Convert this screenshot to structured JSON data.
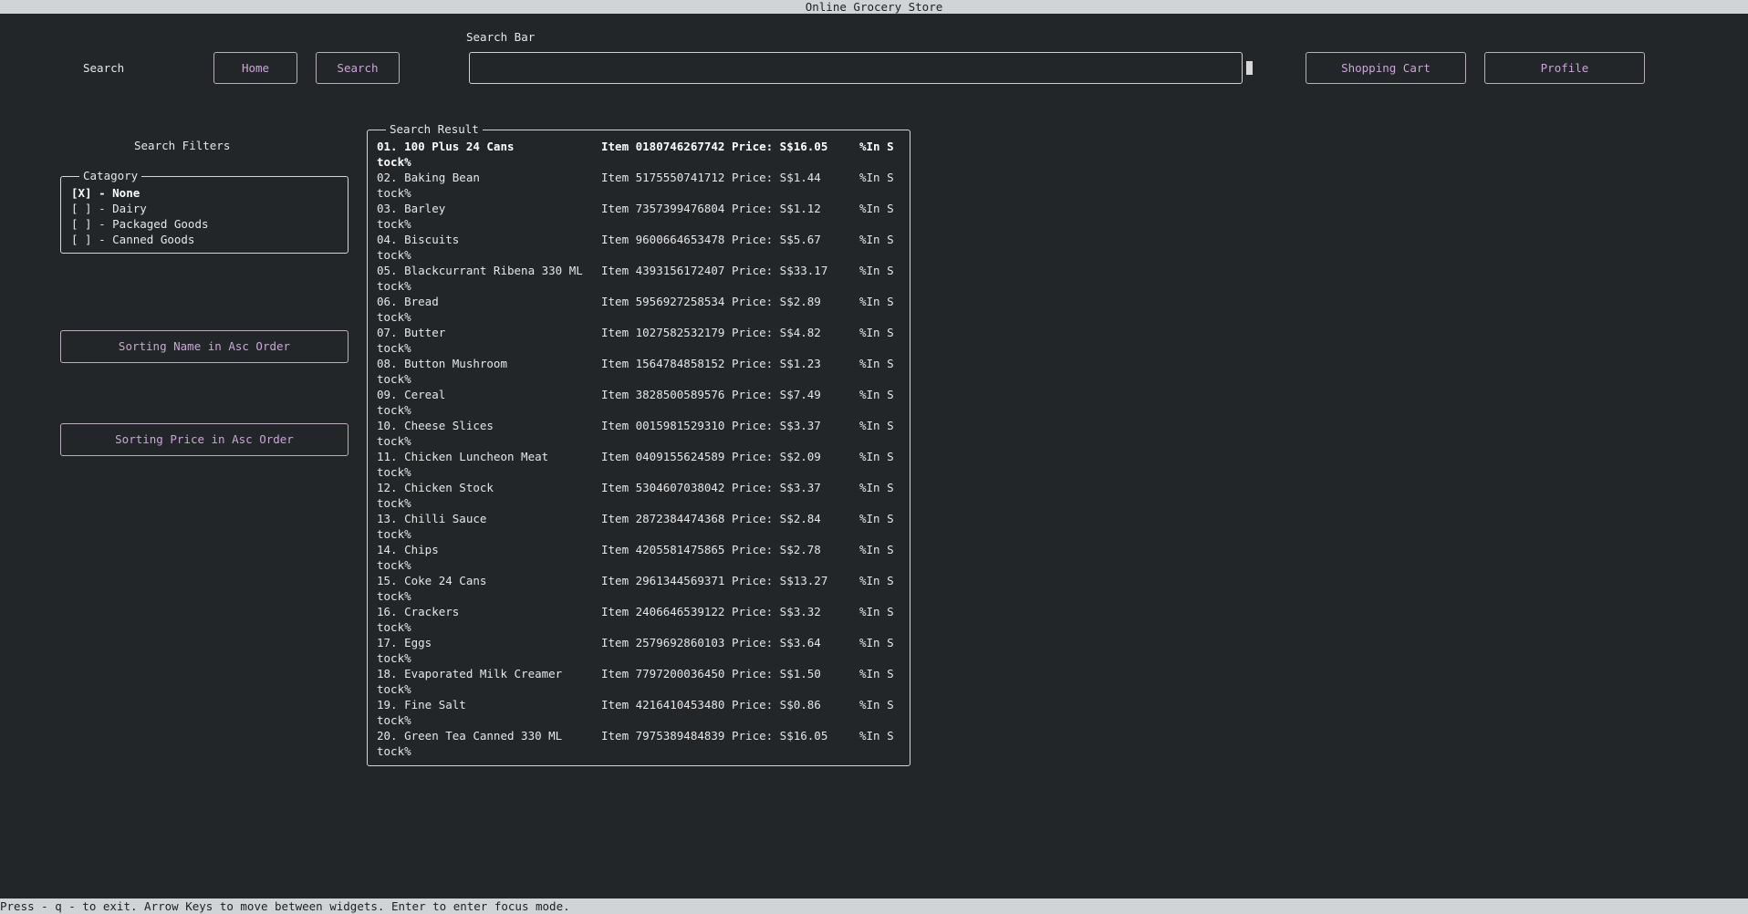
{
  "window": {
    "title": "Online Grocery Store",
    "status_hint": "Press - q - to exit. Arrow Keys to move between widgets. Enter to enter focus mode."
  },
  "nav": {
    "search_label": "Search",
    "home_button": "Home",
    "search_button": "Search",
    "search_bar_label": "Search Bar",
    "search_value": "",
    "cart_button": "Shopping Cart",
    "profile_button": "Profile"
  },
  "filters": {
    "heading": "Search Filters",
    "category_title": "Catagory",
    "categories": [
      {
        "text": "[X] - None",
        "checked": true
      },
      {
        "text": "[ ] - Dairy",
        "checked": false
      },
      {
        "text": "[ ] - Packaged Goods",
        "checked": false
      },
      {
        "text": "[ ] - Canned Goods",
        "checked": false
      }
    ],
    "sort_name_button": "Sorting Name in Asc Order",
    "sort_price_button": "Sorting Price in Asc Order"
  },
  "results": {
    "title": "Search Result",
    "stock_head": "%In S",
    "stock_tail": "tock%",
    "items": [
      {
        "name": "01. 100 Plus 24 Cans",
        "item": "Item 0180746267742 Price: S$16.05"
      },
      {
        "name": "02. Baking Bean",
        "item": "Item 5175550741712 Price: S$1.44"
      },
      {
        "name": "03. Barley",
        "item": "Item 7357399476804 Price: S$1.12"
      },
      {
        "name": "04. Biscuits",
        "item": "Item 9600664653478 Price: S$5.67"
      },
      {
        "name": "05. Blackcurrant Ribena 330 ML",
        "item": "Item 4393156172407 Price: S$33.17"
      },
      {
        "name": "06. Bread",
        "item": "Item 5956927258534 Price: S$2.89"
      },
      {
        "name": "07. Butter",
        "item": "Item 1027582532179 Price: S$4.82"
      },
      {
        "name": "08. Button Mushroom",
        "item": "Item 1564784858152 Price: S$1.23"
      },
      {
        "name": "09. Cereal",
        "item": "Item 3828500589576 Price: S$7.49"
      },
      {
        "name": "10. Cheese Slices",
        "item": "Item 0015981529310 Price: S$3.37"
      },
      {
        "name": "11. Chicken Luncheon Meat",
        "item": "Item 0409155624589 Price: S$2.09"
      },
      {
        "name": "12. Chicken Stock",
        "item": "Item 5304607038042 Price: S$3.37"
      },
      {
        "name": "13. Chilli Sauce",
        "item": "Item 2872384474368 Price: S$2.84"
      },
      {
        "name": "14. Chips",
        "item": "Item 4205581475865 Price: S$2.78"
      },
      {
        "name": "15. Coke 24 Cans",
        "item": "Item 2961344569371 Price: S$13.27"
      },
      {
        "name": "16. Crackers",
        "item": "Item 2406646539122 Price: S$3.32"
      },
      {
        "name": "17. Eggs",
        "item": "Item 2579692860103 Price: S$3.64"
      },
      {
        "name": "18. Evaporated Milk Creamer",
        "item": "Item 7797200036450 Price: S$1.50"
      },
      {
        "name": "19. Fine Salt",
        "item": "Item 4216410453480 Price: S$0.86"
      },
      {
        "name": "20. Green Tea Canned 330 ML",
        "item": "Item 7975389484839 Price: S$16.05"
      }
    ]
  },
  "colors": {
    "background": "#232629",
    "bar": "#d1d4d6",
    "button_text": "#c9a6d6"
  }
}
